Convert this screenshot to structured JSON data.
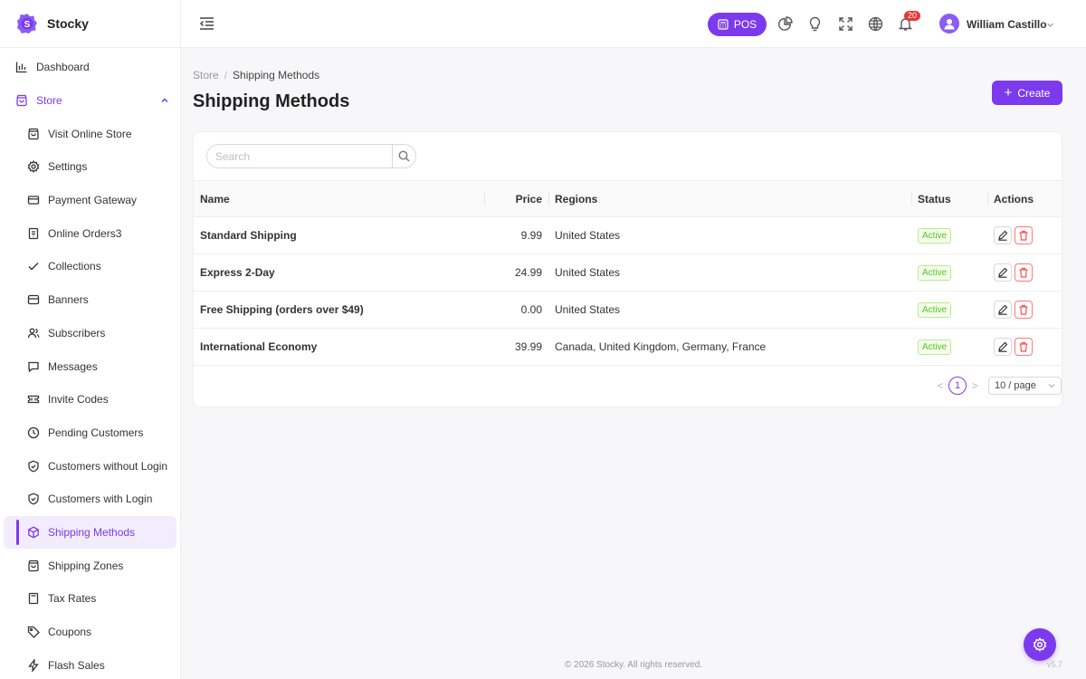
{
  "brand": {
    "name": "Stocky",
    "logo_letter": "S"
  },
  "sidebar": {
    "items": [
      {
        "label": "Dashboard",
        "icon": "bar-chart-icon"
      },
      {
        "label": "Store",
        "icon": "shopping-bag-icon"
      },
      {
        "label": "Visit Online Store",
        "icon": "shopping-bag-icon"
      },
      {
        "label": "Settings",
        "icon": "gear-icon"
      },
      {
        "label": "Payment Gateway",
        "icon": "credit-card-icon"
      },
      {
        "label": "Online Orders3",
        "icon": "order-file-icon"
      },
      {
        "label": "Collections",
        "icon": "check-icon"
      },
      {
        "label": "Banners",
        "icon": "image-icon"
      },
      {
        "label": "Subscribers",
        "icon": "users-icon"
      },
      {
        "label": "Messages",
        "icon": "message-icon"
      },
      {
        "label": "Invite Codes",
        "icon": "ticket-icon"
      },
      {
        "label": "Pending Customers",
        "icon": "clock-icon"
      },
      {
        "label": "Customers without Login",
        "icon": "shield-check-icon"
      },
      {
        "label": "Customers with Login",
        "icon": "shield-check-icon"
      },
      {
        "label": "Shipping Methods",
        "icon": "box-icon"
      },
      {
        "label": "Shipping Zones",
        "icon": "shopping-bag-icon"
      },
      {
        "label": "Tax Rates",
        "icon": "calculator-icon"
      },
      {
        "label": "Coupons",
        "icon": "tag-icon"
      },
      {
        "label": "Flash Sales",
        "icon": "lightning-icon"
      }
    ]
  },
  "header": {
    "pos_label": "POS",
    "notification_count": "20",
    "user_name": "William Castillo",
    "user_avatar_icon": "user-icon"
  },
  "breadcrumb": {
    "parent": "Store",
    "separator": "/",
    "current": "Shipping Methods"
  },
  "page": {
    "title": "Shipping Methods",
    "create_label": "Create"
  },
  "search": {
    "placeholder": "Search",
    "value": ""
  },
  "table": {
    "headers": {
      "name": "Name",
      "price": "Price",
      "regions": "Regions",
      "status": "Status",
      "actions": "Actions"
    },
    "rows": [
      {
        "name": "Standard Shipping",
        "price": "9.99",
        "regions": "United States",
        "status": "Active"
      },
      {
        "name": "Express 2-Day",
        "price": "24.99",
        "regions": "United States",
        "status": "Active"
      },
      {
        "name": "Free Shipping (orders over $49)",
        "price": "0.00",
        "regions": "United States",
        "status": "Active"
      },
      {
        "name": "International Economy",
        "price": "39.99",
        "regions": "Canada, United Kingdom, Germany, France",
        "status": "Active"
      }
    ]
  },
  "pagination": {
    "prev": "<",
    "current_page": "1",
    "next": ">",
    "page_size": "10 / page"
  },
  "footer": {
    "copyright": "© 2026 Stocky. All rights reserved.",
    "version": "v5.7"
  },
  "colors": {
    "accent": "#7c3aed",
    "active_status": "#52c41a",
    "danger": "#ff4d4f",
    "badge": "#e53935"
  }
}
